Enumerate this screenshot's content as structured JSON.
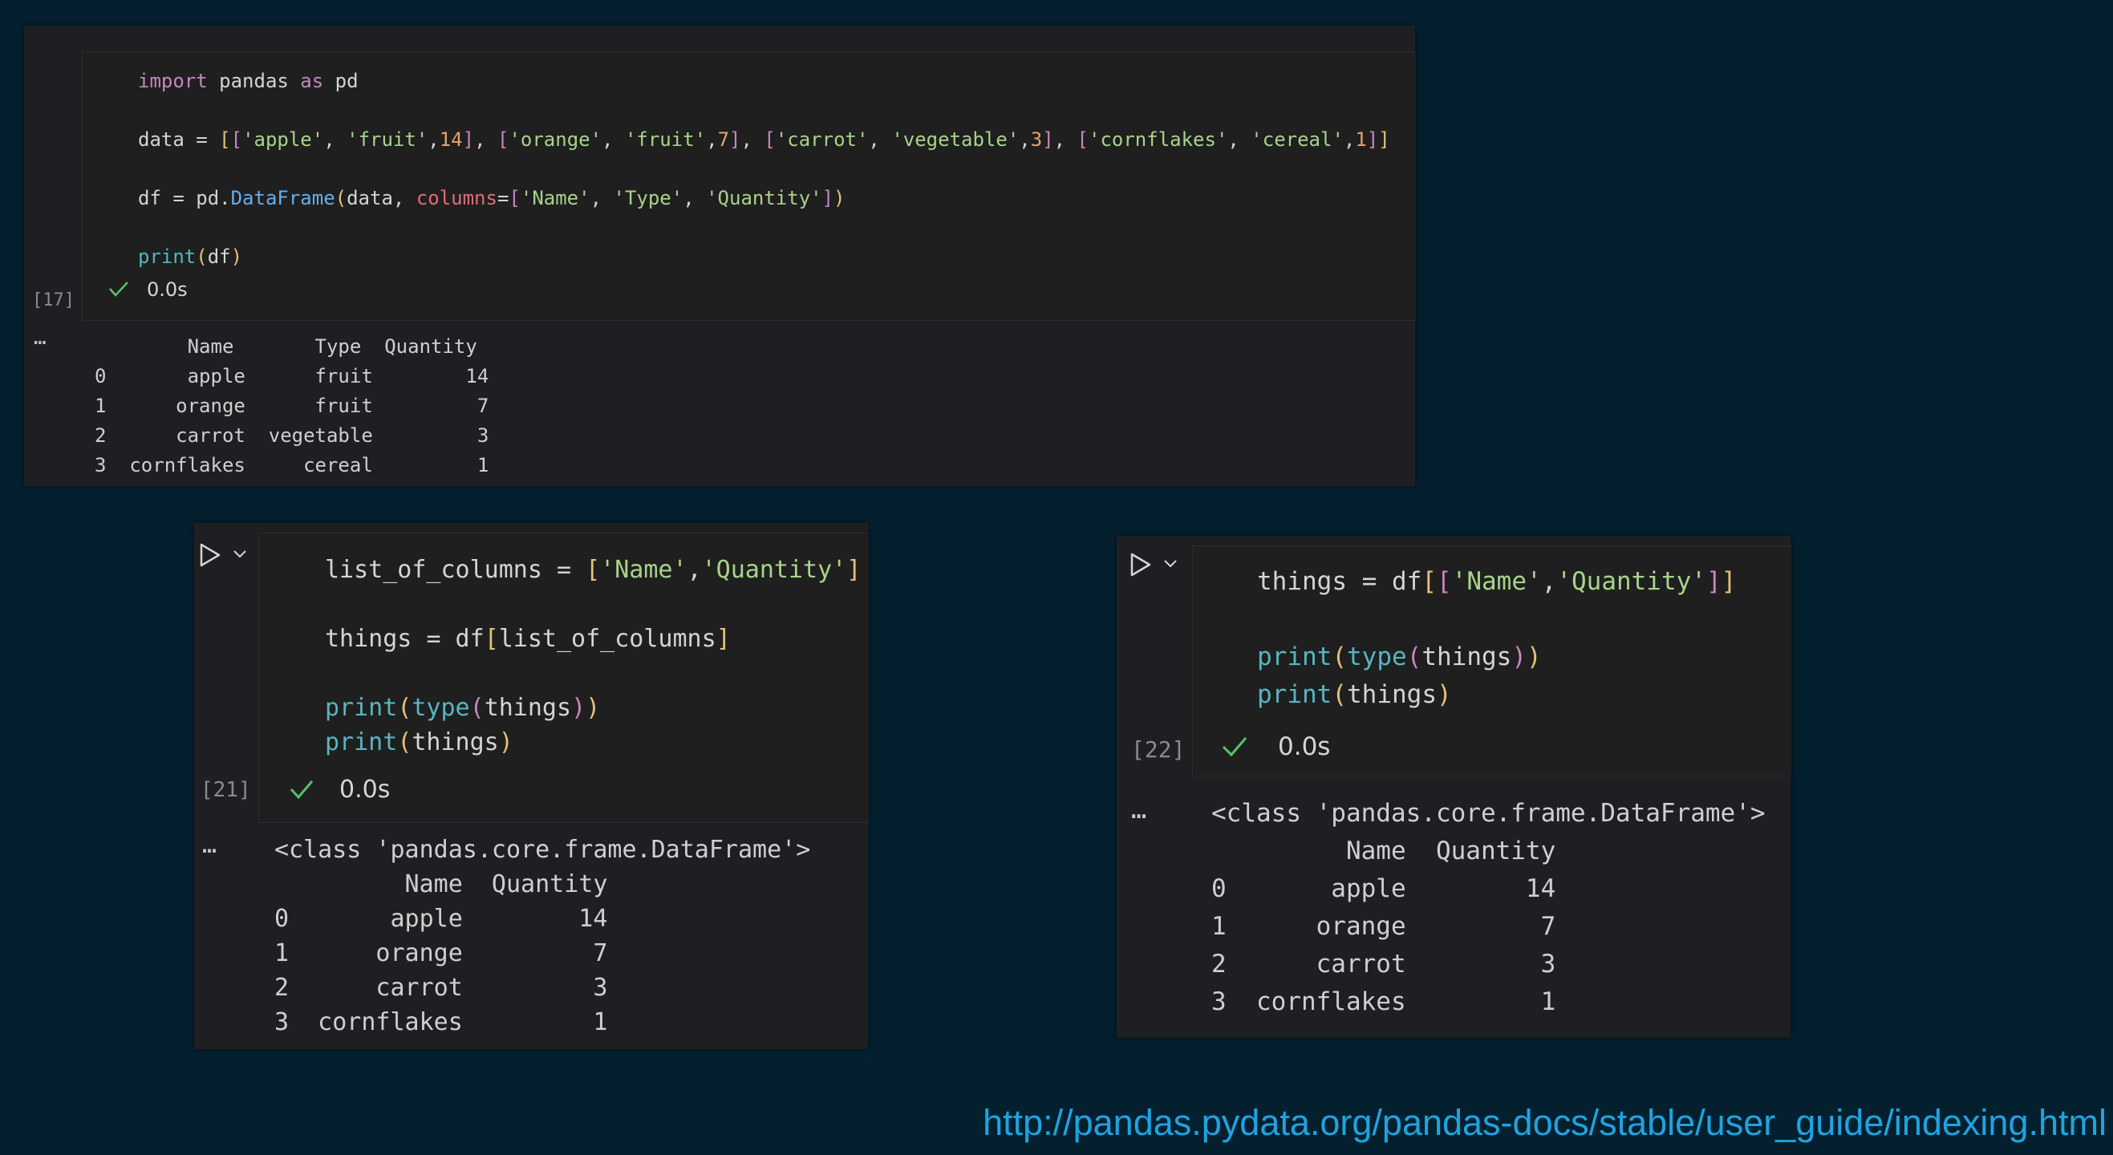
{
  "cell17": {
    "exec_count": "[17]",
    "time": "0.0s",
    "output_dots": "…",
    "output_lines": [
      "        Name       Type  Quantity",
      "0       apple      fruit        14",
      "1      orange      fruit         7",
      "2      carrot  vegetable         3",
      "3  cornflakes     cereal         1"
    ]
  },
  "cell21": {
    "exec_count": "[21]",
    "time": "0.0s",
    "output_dots": "…",
    "output_lines": [
      "<class 'pandas.core.frame.DataFrame'>",
      "         Name  Quantity",
      "0       apple        14",
      "1      orange         7",
      "2      carrot         3",
      "3  cornflakes         1"
    ]
  },
  "cell22": {
    "exec_count": "[22]",
    "time": "0.0s",
    "output_dots": "…",
    "output_lines": [
      "<class 'pandas.core.frame.DataFrame'>",
      "         Name  Quantity",
      "0       apple        14",
      "1      orange         7",
      "2      carrot         3",
      "3  cornflakes         1"
    ]
  },
  "url": "http://pandas.pydata.org/pandas-docs/stable/user_guide/indexing.html",
  "icons": {
    "run": "play-triangle",
    "expand": "chevron-down",
    "success": "check-mark"
  },
  "colors": {
    "background": "#04202f",
    "panel": "#1e1f22",
    "success": "#57c26a",
    "url": "#1fa3e0"
  }
}
